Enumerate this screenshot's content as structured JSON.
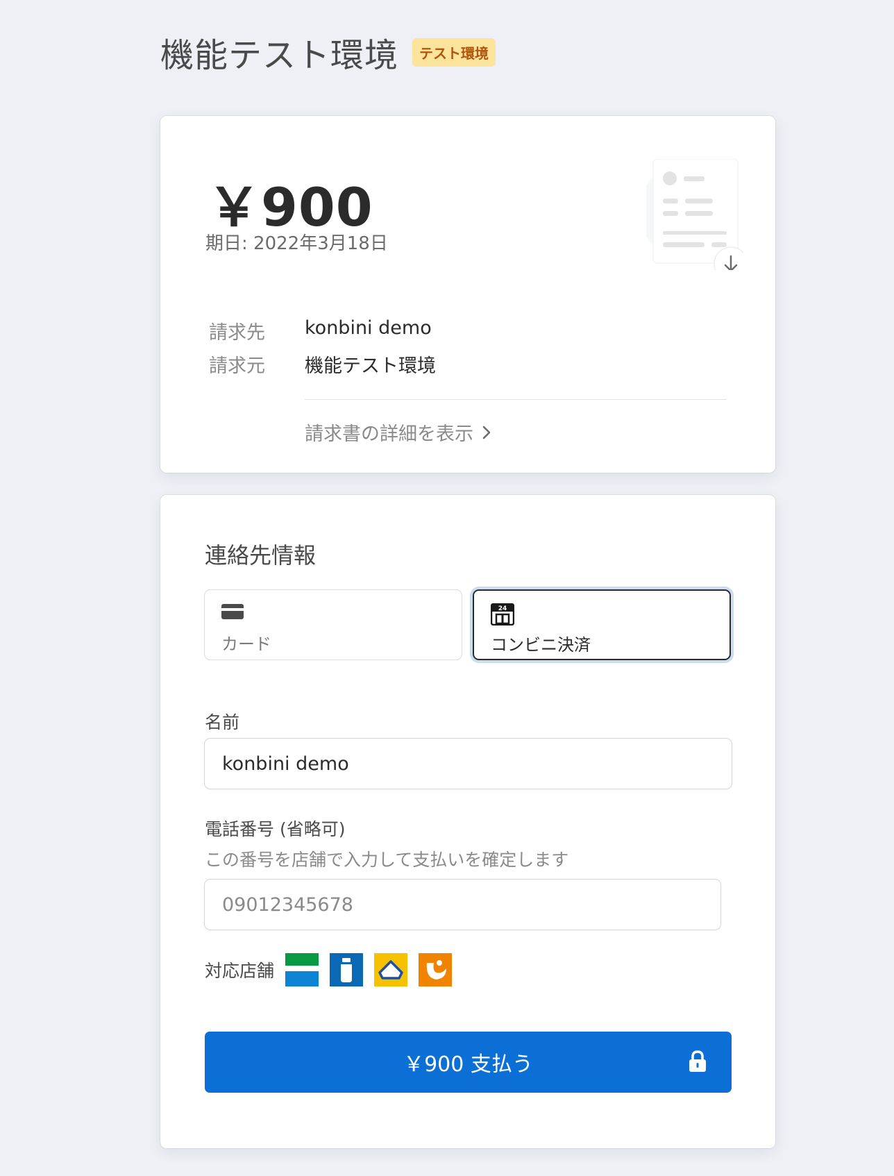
{
  "header": {
    "title": "機能テスト環境",
    "badge": "テスト環境"
  },
  "invoice": {
    "amount": "￥900",
    "due_date": "期日: 2022年3月18日",
    "document_icon": "invoice-download-icon",
    "billed_to_label": "請求先",
    "billed_to_value": "konbini demo",
    "billed_from_label": "請求元",
    "billed_from_value": "機能テスト環境",
    "details_link": "請求書の詳細を表示"
  },
  "payment": {
    "section_title": "連絡先情報",
    "methods": [
      {
        "label": "カード",
        "icon": "credit-card-icon",
        "selected": false
      },
      {
        "label": "コンビニ決済",
        "icon": "convenience-store-24-icon",
        "selected": true
      }
    ],
    "name_label": "名前",
    "name_value": "konbini demo",
    "phone_label": "電話番号 (省略可)",
    "phone_hint": "この番号を店舗で入力して支払いを確定します",
    "phone_placeholder": "09012345678",
    "stores_label": "対応店舗",
    "stores": [
      "familymart-logo",
      "lawson-logo",
      "ministop-logo",
      "seicomart-logo"
    ],
    "pay_button": "￥900 支払う"
  },
  "colors": {
    "primary": "#0b6fd6",
    "badge_bg": "#fde49c",
    "badge_text": "#b2540c",
    "background": "#eef0f5"
  }
}
